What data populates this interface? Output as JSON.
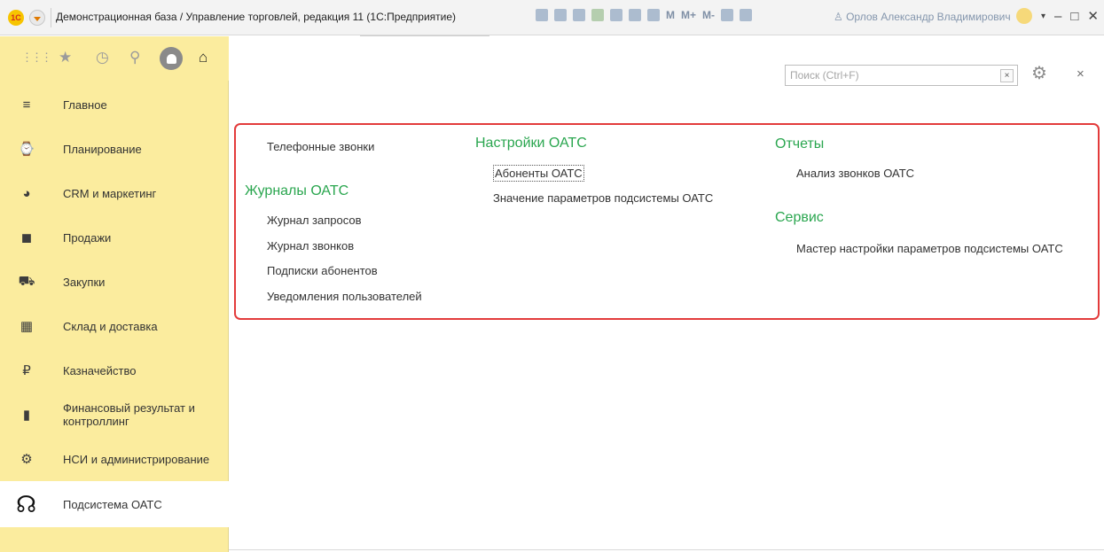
{
  "window": {
    "logo_text": "1С",
    "title": "Демонстрационная база / Управление торговлей, редакция 11 (1С:Предприятие)",
    "toolbar_memory": [
      "M",
      "M+",
      "M-"
    ],
    "user": "♙ Орлов Александр Владимирович",
    "controls": {
      "minimize": "–",
      "maximize": "□",
      "close": "✕"
    }
  },
  "sidebar": {
    "toolbar": {
      "apps_icon": "⋮⋮⋮",
      "star_icon": "★",
      "history_icon": "◷",
      "search_icon": "⚲",
      "home_icon": "⌂"
    },
    "items": [
      {
        "label": "Главное",
        "icon": "≡"
      },
      {
        "label": "Планирование",
        "icon": "⌚"
      },
      {
        "label": "CRM и маркетинг",
        "icon": "◕"
      },
      {
        "label": "Продажи",
        "icon": "◼"
      },
      {
        "label": "Закупки",
        "icon": "⛟"
      },
      {
        "label": "Склад и доставка",
        "icon": "▦"
      },
      {
        "label": "Казначейство",
        "icon": "₽"
      },
      {
        "label": "Финансовый результат и контроллинг",
        "icon": "▮"
      },
      {
        "label": "НСИ и администрирование",
        "icon": "⚙"
      },
      {
        "label": "Подсистема ОАТС",
        "icon": "☊"
      }
    ],
    "active_index": 9
  },
  "search": {
    "placeholder": "Поиск (Ctrl+F)",
    "clear": "×"
  },
  "panel": {
    "close": "×",
    "col1": {
      "top_cmd": "Телефонные звонки",
      "group": "Журналы ОАТС",
      "cmds": [
        "Журнал запросов",
        "Журнал звонков",
        "Подписки абонентов",
        "Уведомления пользователей"
      ]
    },
    "col2": {
      "group": "Настройки ОАТС",
      "cmds": [
        "Абоненты ОАТС",
        "Значение параметров подсистемы ОАТС"
      ]
    },
    "col3": {
      "group_reports": "Отчеты",
      "reports_cmds": [
        "Анализ звонков ОАТС"
      ],
      "group_service": "Сервис",
      "service_cmds": [
        "Мастер настройки параметров подсистемы ОАТС"
      ]
    }
  },
  "colors": {
    "sidebar_bg": "#fbec9e",
    "group_green": "#2aa64f",
    "frame_red": "#e33b3b"
  }
}
